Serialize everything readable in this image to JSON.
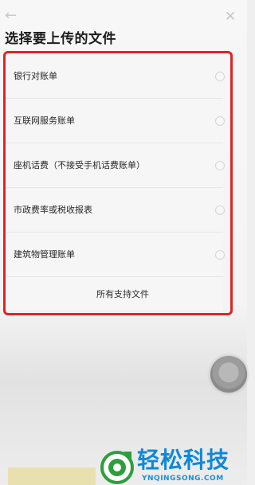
{
  "header": {
    "back_icon": "arrow-left-icon",
    "close_icon": "close-icon",
    "title": "选择要上传的文件"
  },
  "file_types": [
    {
      "label": "银行对账单"
    },
    {
      "label": "互联网服务账单"
    },
    {
      "label": "座机话费（不接受手机话费账单）"
    },
    {
      "label": "市政费率或税收报表"
    },
    {
      "label": "建筑物管理账单"
    }
  ],
  "all_supported_files": "所有支持文件",
  "watermark": {
    "name": "轻松科技",
    "url": "YNQINGSONG.COM"
  },
  "colors": {
    "highlight": "#e02424",
    "brand": "#0e88d8",
    "logo_green": "#2e9e3c"
  }
}
